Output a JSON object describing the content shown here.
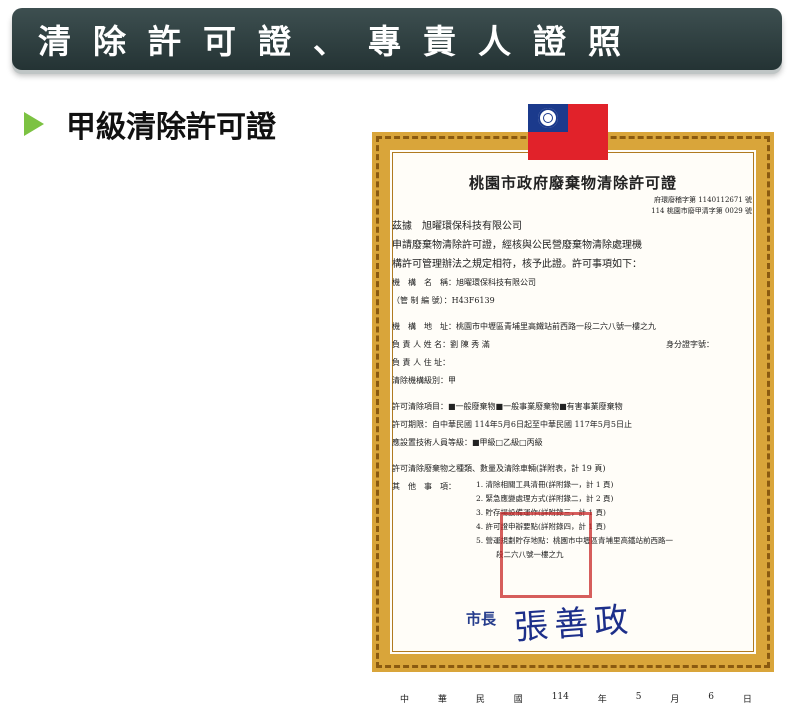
{
  "header": {
    "title": "清除許可證、專責人證照"
  },
  "section": {
    "label": "甲級清除許可證"
  },
  "certificate": {
    "title": "桃園市政府廢棄物清除許可證",
    "ref_line1": "府環廢稽字第 1140112671 號",
    "ref_line2": "114 桃園市廢甲清字第 0029 號",
    "recipient": "茲據　旭曜環保科技有限公司",
    "intro1": "申請廢棄物清除許可證，經核與公民營廢棄物清除處理機",
    "intro2": "構許可管理辦法之規定相符，核予此證。許可事項如下：",
    "org_name": "機　構　名　稱：旭曜環保科技有限公司",
    "control_no": "（管 制 編 號）：H43F6139",
    "address": "機　構　地　址：桃園市中壢區青埔里高鐵站前西路一段二六八號一樓之九",
    "owner": "負 責 人 姓 名：劉 陳 秀 滿",
    "id_label": "身分證字號：",
    "owner_address": "負 責 人 住 址：",
    "grade": "清除機構級別：甲",
    "items": "許可清除項目：■一般廢棄物■一般事業廢棄物■有害事業廢棄物",
    "period": "許可期限：自中華民國 114年5月6日起至中華民國 117年5月5日止",
    "staff": "應設置技術人員等級：■甲級□乙級□丙級",
    "types": "許可清除廢棄物之種類、數量及清除車輛(詳附表，計 19 頁)",
    "others_label": "其　他　事　項：",
    "notes": [
      "1. 清除相關工具清冊(詳附錄一，計 1 頁)",
      "2. 緊急應變處理方式(詳附錄二，計 2 頁)",
      "3. 貯存場設備運作(詳附錄三，計 1 頁)",
      "4. 許可證申辦要點(詳附錄四，計 1 頁)",
      "5. 營運規劃貯存地點：桃園市中壢區青埔里高鐵站前西路一",
      "段二六八號一樓之九"
    ],
    "mayor_label": "市長",
    "signature": "張善政",
    "date": [
      "中",
      "華",
      "民",
      "國",
      "114",
      "年",
      "5",
      "月",
      "6",
      "日"
    ]
  }
}
